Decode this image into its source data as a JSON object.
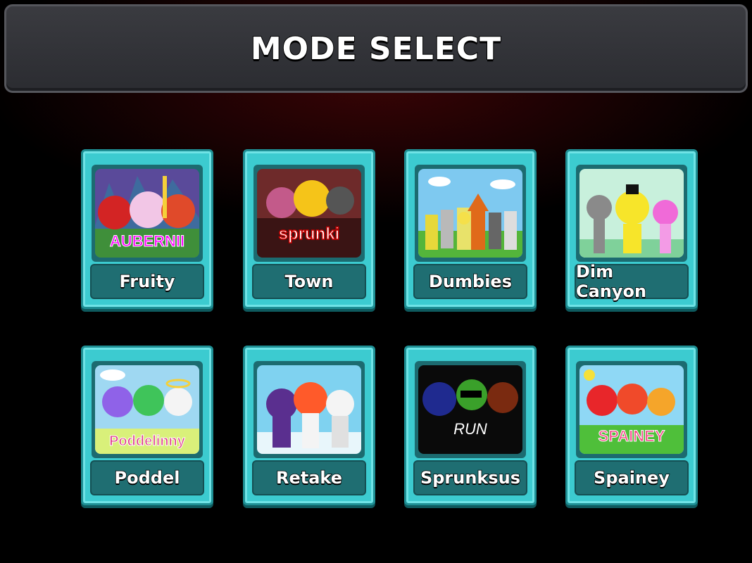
{
  "header": {
    "title": "MODE SELECT"
  },
  "modes": [
    {
      "label": "Fruity",
      "thumb_text": "AUBERNII"
    },
    {
      "label": "Town",
      "thumb_text": "sprunki"
    },
    {
      "label": "Dumbies",
      "thumb_text": ""
    },
    {
      "label": "Dim Canyon",
      "thumb_text": ""
    },
    {
      "label": "Poddel",
      "thumb_text": "Poddelinny"
    },
    {
      "label": "Retake",
      "thumb_text": ""
    },
    {
      "label": "Sprunksus",
      "thumb_text": "RUN"
    },
    {
      "label": "Spainey",
      "thumb_text": "SPAINEY"
    }
  ],
  "colors": {
    "card_face": "#3ccbd0",
    "card_border": "#1e8f94",
    "label_bg": "#1f6e72",
    "title_bar_bg": "#34353a"
  }
}
